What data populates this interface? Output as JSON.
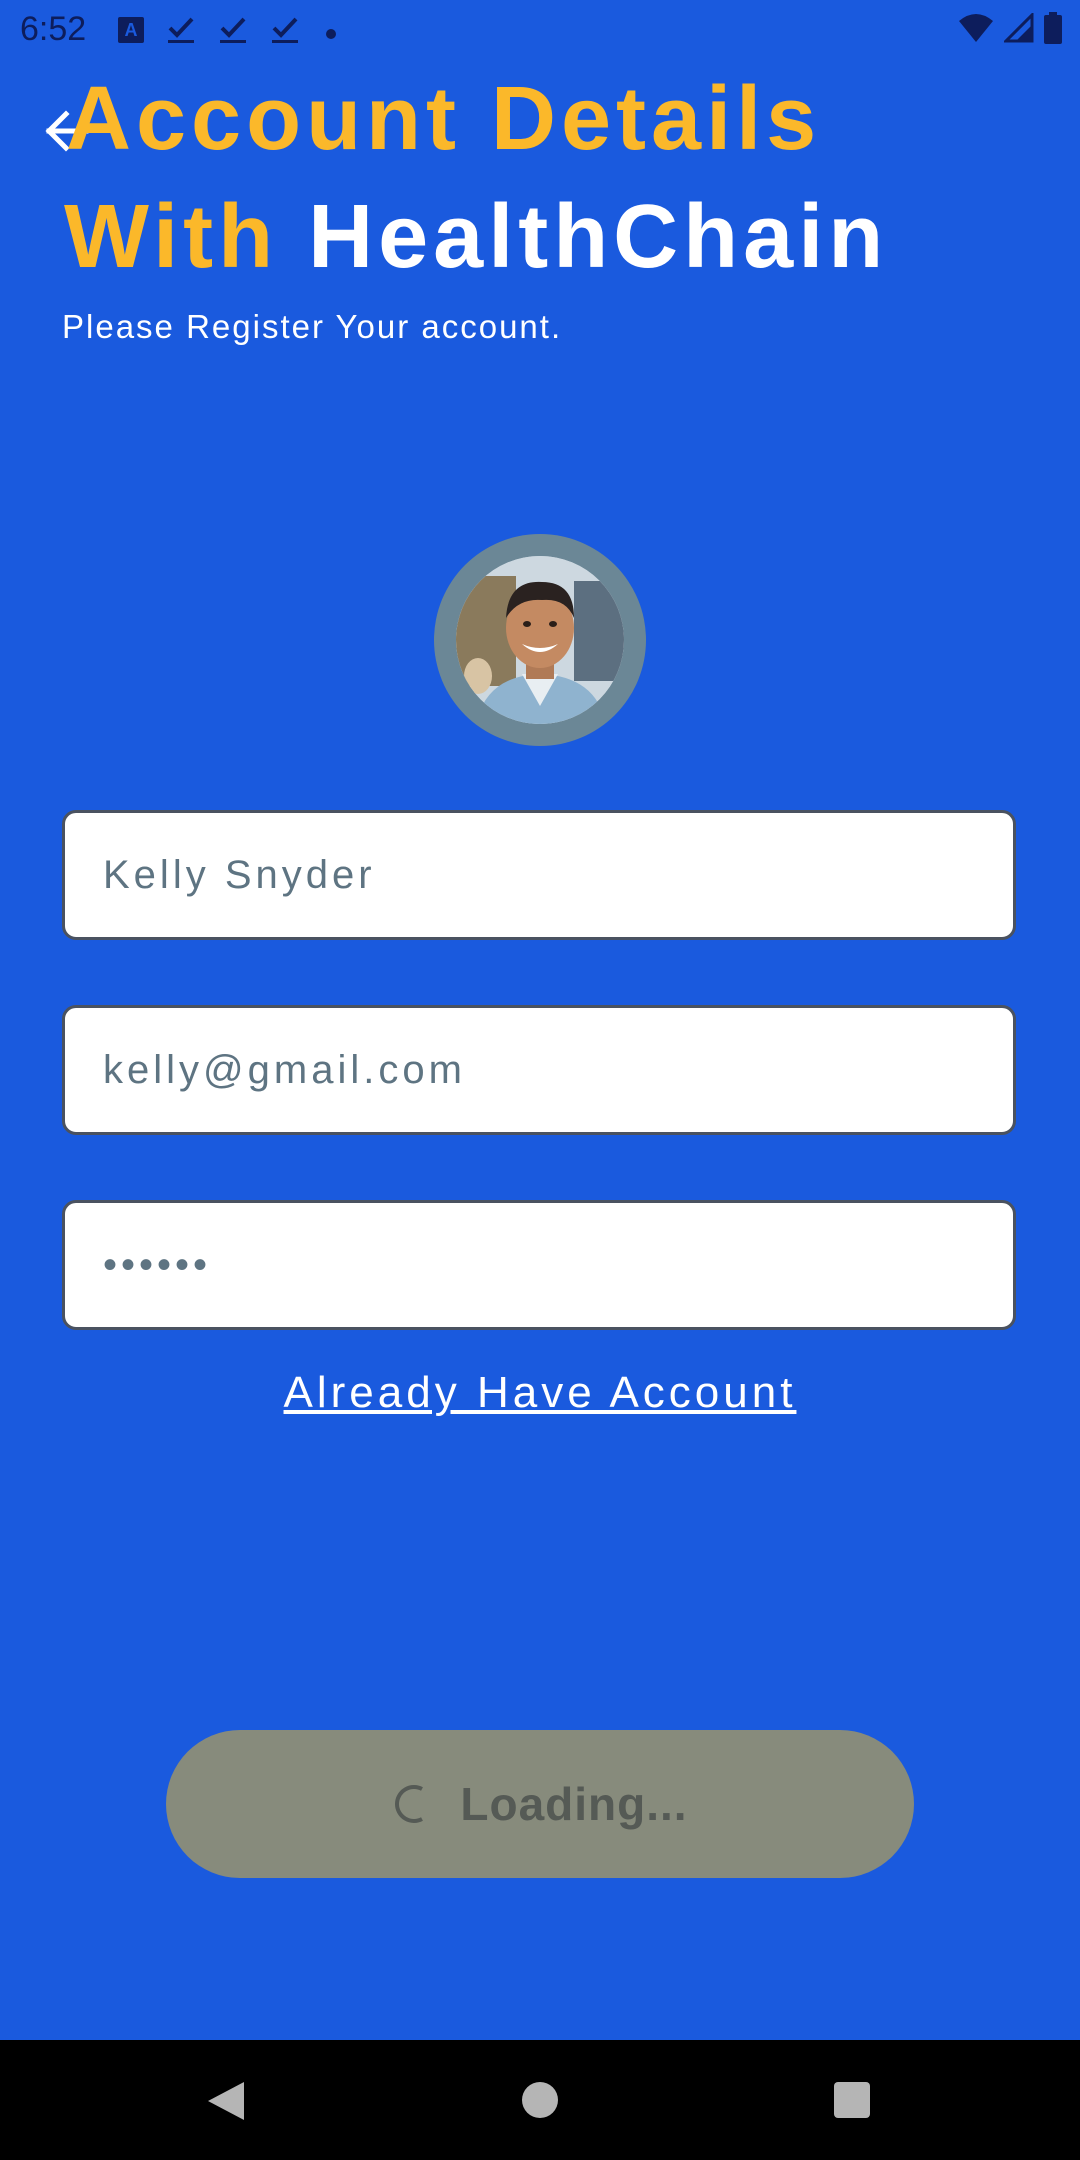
{
  "status_bar": {
    "time": "6:52",
    "icons": [
      "keyboard-a-icon",
      "download-done-icon",
      "download-done-icon",
      "download-done-icon",
      "notification-dot-icon",
      "wifi-icon",
      "signal-icon",
      "battery-icon"
    ]
  },
  "header": {
    "title_line1": "Account Details",
    "title_with": "With",
    "title_brand": "HealthChain",
    "subtitle": "Please Register Your account."
  },
  "form": {
    "name_value": "Kelly Snyder",
    "email_value": "kelly@gmail.com",
    "password_value": "••••••",
    "login_link": "Already Have Account"
  },
  "submit": {
    "label": "Loading..."
  },
  "colors": {
    "background": "#1a5ade",
    "accent": "#fbb82a",
    "button_disabled": "#878b7c"
  }
}
